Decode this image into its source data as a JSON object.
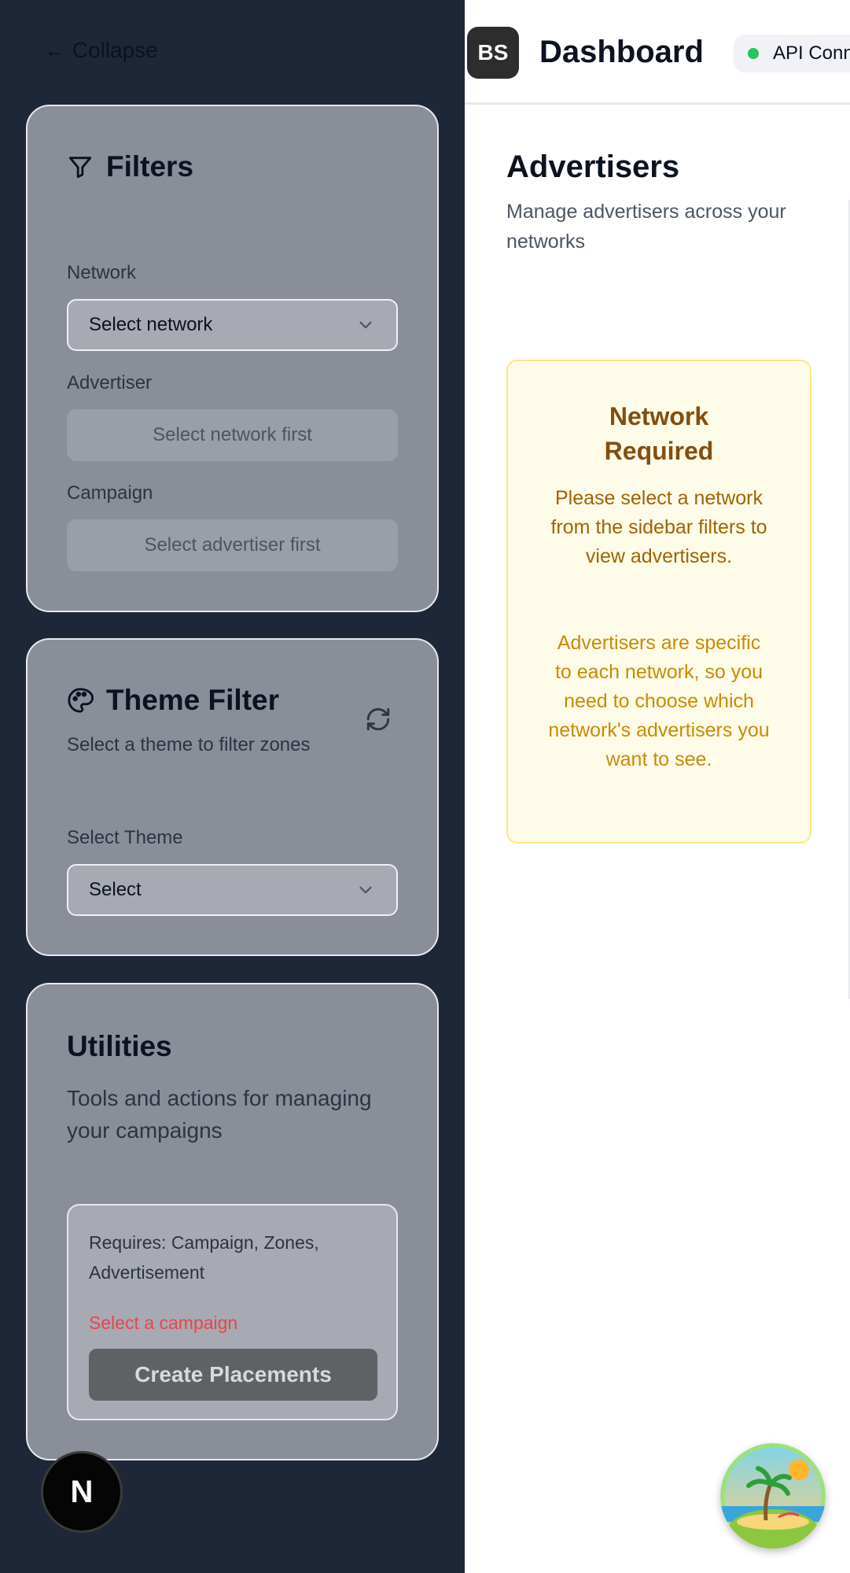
{
  "sidebar": {
    "collapse_label": "← Collapse",
    "filters": {
      "title": "Filters",
      "network_label": "Network",
      "network_value": "Select network",
      "advertiser_label": "Advertiser",
      "advertiser_placeholder": "Select network first",
      "campaign_label": "Campaign",
      "campaign_placeholder": "Select advertiser first"
    },
    "theme_filter": {
      "title": "Theme Filter",
      "subtitle": "Select a theme to filter zones",
      "select_label": "Select Theme",
      "select_value": "Select"
    },
    "utilities": {
      "title": "Utilities",
      "subtitle": "Tools and actions for managing your campaigns",
      "requires_text": "Requires: Campaign, Zones, Advertisement",
      "warning": "Select a campaign",
      "create_button": "Create Placements"
    },
    "badge_letter": "N"
  },
  "header": {
    "avatar_initials": "BS",
    "title": "Dashboard",
    "api_status": "API Connected",
    "status_color": "#22c55e"
  },
  "main": {
    "title": "Advertisers",
    "subtitle": "Manage advertisers across your networks",
    "notice": {
      "title": "Network Required",
      "body": "Please select a network from the sidebar filters to view advertisers.",
      "body2": "Advertisers are specific to each network, so you need to choose which network's advertisers you want to see."
    }
  },
  "icons": {
    "filter": "filter-icon",
    "palette": "palette-icon",
    "refresh": "refresh-icon",
    "chevron": "chevron-down-icon",
    "beach": "beach-island-icon"
  }
}
